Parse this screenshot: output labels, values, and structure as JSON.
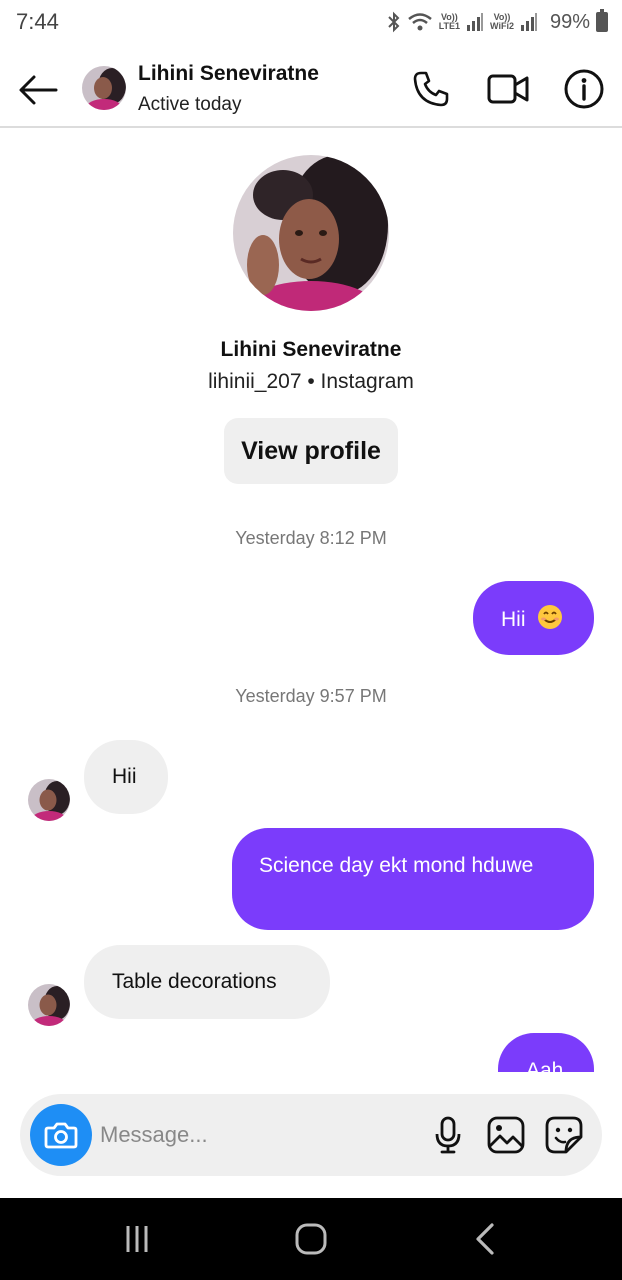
{
  "status_bar": {
    "time": "7:44",
    "volte1_top": "Vo))",
    "volte1_bottom": "LTE1",
    "volte2_top": "Vo))",
    "volte2_bottom": "WiFi2",
    "battery": "99%"
  },
  "header": {
    "contact_name": "Lihini Seneviratne",
    "status": "Active today"
  },
  "profile": {
    "name": "Lihini Seneviratne",
    "subtitle": "lihinii_207 • Instagram",
    "view_profile_label": "View profile"
  },
  "conversation": {
    "timestamp_1": "Yesterday 8:12 PM",
    "timestamp_2": "Yesterday 9:57 PM",
    "messages": [
      {
        "direction": "outgoing",
        "text": "Hii",
        "emoji": "smiling-face-emoji"
      },
      {
        "direction": "incoming",
        "text": "Hii"
      },
      {
        "direction": "outgoing",
        "text": "Science day ekt mond hduwe"
      },
      {
        "direction": "incoming",
        "text": "Table decorations"
      },
      {
        "direction": "outgoing",
        "text": "Aah"
      }
    ]
  },
  "composer": {
    "placeholder": "Message..."
  },
  "colors": {
    "outgoing_bubble": "#7b3cfb",
    "incoming_bubble": "#efefef",
    "camera_button": "#1e8ef5",
    "nav_bar": "#000000"
  },
  "icons": [
    "back-arrow-icon",
    "phone-icon",
    "video-camera-icon",
    "info-icon",
    "camera-icon",
    "microphone-icon",
    "gallery-icon",
    "sticker-icon",
    "recents-icon",
    "home-icon",
    "nav-back-icon"
  ]
}
